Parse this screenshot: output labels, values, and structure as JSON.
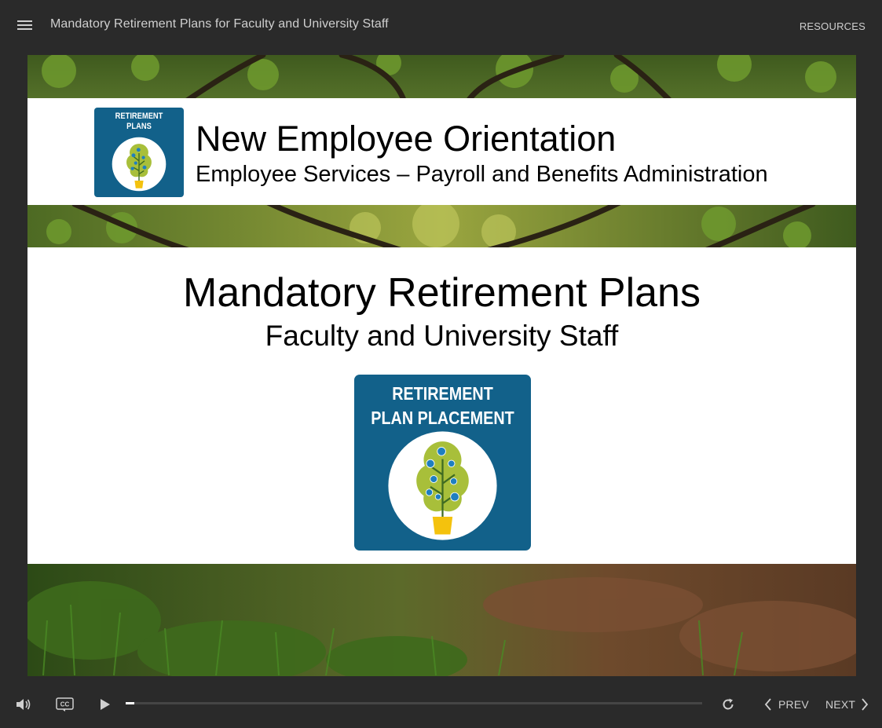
{
  "header": {
    "course_title": "Mandatory Retirement Plans for Faculty and University Staff",
    "resources_label": "RESOURCES",
    "menu_icon": "hamburger-menu-icon"
  },
  "slide": {
    "header_badge": {
      "line1": "RETIREMENT",
      "line2": "PLANS"
    },
    "orientation_title": "New Employee Orientation",
    "orientation_subtitle": "Employee Services – Payroll and Benefits Administration",
    "main_title": "Mandatory Retirement Plans",
    "main_subtitle": "Faculty and University Staff",
    "placement_badge": {
      "line1": "RETIREMENT",
      "line2": "PLAN PLACEMENT"
    },
    "colors": {
      "badge_blue": "#12618a",
      "tree_green": "#a8bf3a",
      "pot_yellow": "#f4c20d",
      "coin_blue": "#1f7fc0"
    }
  },
  "controls": {
    "volume_icon": "volume-icon",
    "cc_label": "CC",
    "play_icon": "play-icon",
    "progress": 0.015,
    "replay_icon": "replay-icon",
    "prev_label": "PREV",
    "next_label": "NEXT"
  }
}
